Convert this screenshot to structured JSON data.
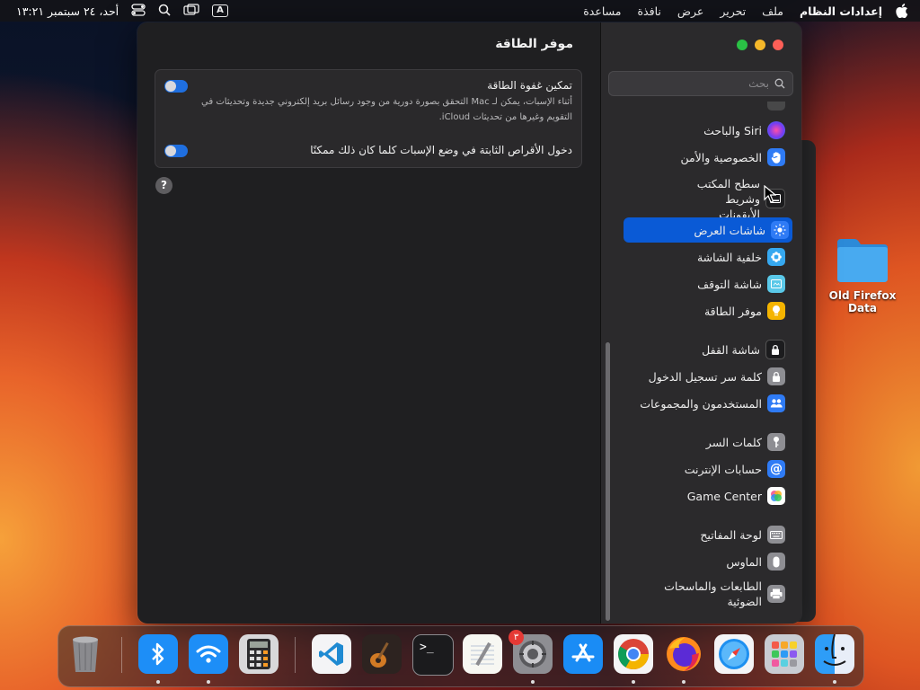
{
  "menubar": {
    "app_name": "إعدادات النظام",
    "menus": [
      "ملف",
      "تحرير",
      "عرض",
      "نافذة",
      "مساعدة"
    ],
    "input_badge": "A",
    "clock": "أحد، ٢٤ سبتمبر ١٣:٢١"
  },
  "desktop": {
    "folder_label": "Old Firefox Data"
  },
  "window": {
    "title": "موفر الطاقة",
    "search_placeholder": "بحث",
    "sidebar": [
      {
        "label": "Siri والباحث",
        "icon": "siri-icon",
        "color": "#7a3cf0"
      },
      {
        "label": "الخصوصية والأمن",
        "icon": "hand-icon",
        "color": "#2f7bf5"
      },
      {
        "label": "سطح المكتب وشريط الأيقونات",
        "icon": "dock-icon",
        "color": "#1c1c1e"
      },
      {
        "label": "شاشات العرض",
        "icon": "brightness-icon",
        "color": "#2f7bf5",
        "selected": true
      },
      {
        "label": "خلفية الشاشة",
        "icon": "flower-icon",
        "color": "#36a8f0"
      },
      {
        "label": "شاشة التوقف",
        "icon": "screensaver-icon",
        "color": "#5ac8e8"
      },
      {
        "label": "موفر الطاقة",
        "icon": "bulb-icon",
        "color": "#f5b400"
      },
      {
        "label": "شاشة القفل",
        "icon": "lock-icon",
        "color": "#1c1c1e"
      },
      {
        "label": "كلمة سر تسجيل الدخول",
        "icon": "lock-small-icon",
        "color": "#8e8e93"
      },
      {
        "label": "المستخدمون والمجموعات",
        "icon": "users-icon",
        "color": "#2f7bf5"
      },
      {
        "label": "كلمات السر",
        "icon": "key-icon",
        "color": "#8e8e93"
      },
      {
        "label": "حسابات الإنترنت",
        "icon": "at-icon",
        "color": "#2f7bf5"
      },
      {
        "label": "Game Center",
        "icon": "game-center-icon",
        "color": "#ffffff"
      },
      {
        "label": "لوحة المفاتيح",
        "icon": "keyboard-icon",
        "color": "#8e8e93"
      },
      {
        "label": "الماوس",
        "icon": "mouse-icon",
        "color": "#8e8e93"
      },
      {
        "label": "الطابعات والماسحات الضوئية",
        "icon": "printer-icon",
        "color": "#8e8e93"
      }
    ],
    "settings": [
      {
        "title": "تمكين غفوة الطاقة",
        "description": "أثناء الإسبات، يمكن لـ Mac التحقق بصورة دورية من وجود رسائل بريد إلكتروني جديدة وتحديثات في التقويم وغيرها من تحديثات iCloud.",
        "enabled": true
      },
      {
        "title": "دخول الأقراص الثابتة في وضع الإسبات كلما كان ذلك ممكنًا",
        "enabled": true
      }
    ],
    "help_label": "?"
  },
  "dock": {
    "apps": [
      {
        "name": "trash",
        "running": false
      },
      {
        "name": "bluetooth",
        "running": true
      },
      {
        "name": "wifi",
        "running": true
      },
      {
        "name": "calculator",
        "running": false
      },
      {
        "name": "vscode",
        "running": false
      },
      {
        "name": "garageband",
        "running": false
      },
      {
        "name": "terminal",
        "running": false
      },
      {
        "name": "textedit",
        "running": false
      },
      {
        "name": "system-settings",
        "running": true,
        "badge": "٣"
      },
      {
        "name": "app-store",
        "running": false
      },
      {
        "name": "chrome",
        "running": true
      },
      {
        "name": "firefox",
        "running": true
      },
      {
        "name": "safari",
        "running": false
      },
      {
        "name": "launchpad",
        "running": false
      },
      {
        "name": "finder",
        "running": true
      }
    ]
  },
  "colors": {
    "accent": "#0a5ad6",
    "toggle_on": "#1f6fe0"
  }
}
